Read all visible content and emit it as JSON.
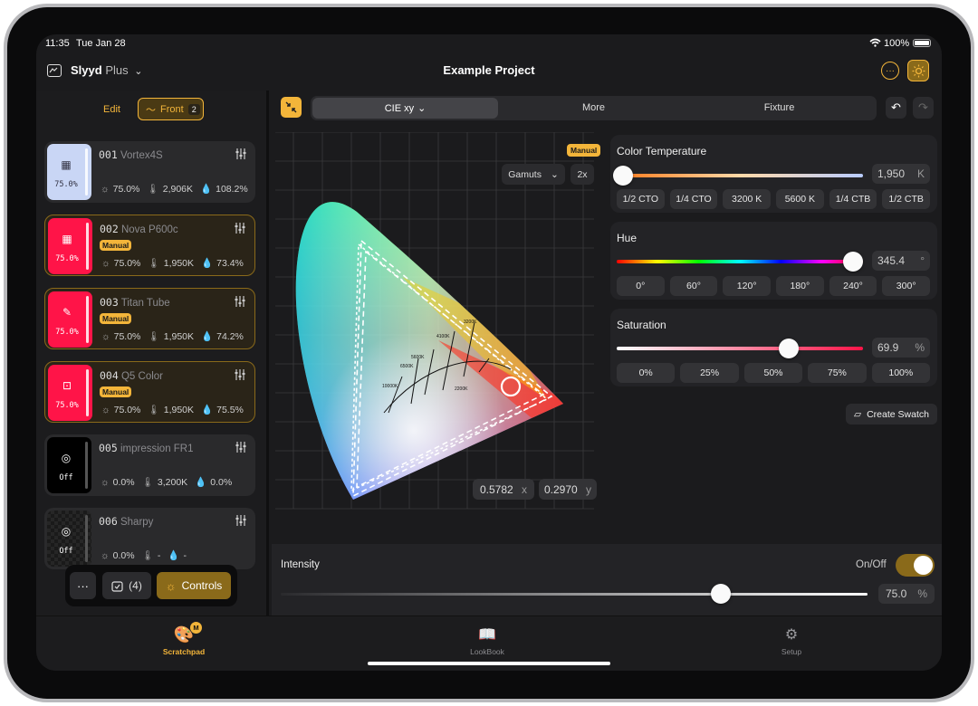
{
  "status": {
    "time": "11:35",
    "date": "Tue Jan 28",
    "battery": "100%"
  },
  "header": {
    "app_name": "Slyyd",
    "app_tier": "Plus",
    "project_title": "Example Project"
  },
  "left_bar": {
    "edit_label": "Edit",
    "group_label": "Front",
    "group_count": "2"
  },
  "fixtures": [
    {
      "id": "001",
      "name": "Vortex4S",
      "thumb_label": "75.0%",
      "thumb_color": "#c9d6f5",
      "intensity": "75.0%",
      "cct": "2,906K",
      "tint": "108.2%",
      "manual": false
    },
    {
      "id": "002",
      "name": "Nova P600c",
      "thumb_label": "75.0%",
      "thumb_color": "#ff1448",
      "intensity": "75.0%",
      "cct": "1,950K",
      "tint": "73.4%",
      "manual": true,
      "badge": "Manual"
    },
    {
      "id": "003",
      "name": "Titan Tube",
      "thumb_label": "75.0%",
      "thumb_color": "#ff1448",
      "intensity": "75.0%",
      "cct": "1,950K",
      "tint": "74.2%",
      "manual": true,
      "badge": "Manual"
    },
    {
      "id": "004",
      "name": "Q5 Color",
      "thumb_label": "75.0%",
      "thumb_color": "#ff1448",
      "intensity": "75.0%",
      "cct": "1,950K",
      "tint": "75.5%",
      "manual": true,
      "badge": "Manual"
    },
    {
      "id": "005",
      "name": "impression FR1",
      "thumb_label": "Off",
      "thumb_color": "#000000",
      "intensity": "0.0%",
      "cct": "3,200K",
      "tint": "0.0%",
      "manual": false
    },
    {
      "id": "006",
      "name": "Sharpy",
      "thumb_label": "Off",
      "thumb_color": "#1e1e1e",
      "intensity": "0.0%",
      "cct": "-",
      "tint": "-",
      "manual": false
    }
  ],
  "floating": {
    "more": "···",
    "selected": "(4)",
    "controls": "Controls"
  },
  "segments": [
    "CIE xy",
    "More",
    "Fixture"
  ],
  "cie": {
    "badge": "Manual",
    "gamuts": "Gamuts",
    "zoom": "2x",
    "x_value": "0.5782",
    "x_label": "x",
    "y_value": "0.2970",
    "y_label": "y",
    "cct_labels": [
      "10000K",
      "6500K",
      "5600K",
      "4100K",
      "3200K",
      "2200K"
    ],
    "selected_x": 0.5782,
    "selected_y": 0.297
  },
  "color_temp": {
    "title": "Color Temperature",
    "value": "1,950",
    "unit": "K",
    "level": 0.0,
    "presets": [
      "1/2 CTO",
      "1/4 CTO",
      "3200 K",
      "5600 K",
      "1/4 CTB",
      "1/2 CTB"
    ]
  },
  "hue": {
    "title": "Hue",
    "value": "345.4",
    "unit": "°",
    "level": 0.959,
    "presets": [
      "0°",
      "60°",
      "120°",
      "180°",
      "240°",
      "300°"
    ]
  },
  "saturation": {
    "title": "Saturation",
    "value": "69.9",
    "unit": "%",
    "level": 0.699,
    "presets": [
      "0%",
      "25%",
      "50%",
      "75%",
      "100%"
    ]
  },
  "swatch": {
    "label": "Create Swatch"
  },
  "intensity": {
    "title": "Intensity",
    "onoff_label": "On/Off",
    "value": "75.0",
    "unit": "%",
    "level": 0.75,
    "on": true
  },
  "tabs": [
    {
      "label": "Scratchpad",
      "badge": "M"
    },
    {
      "label": "LookBook"
    },
    {
      "label": "Setup"
    }
  ],
  "colors": {
    "accent": "#f3b53a",
    "manual_red": "#ff1448",
    "background": "#1b1b1d"
  }
}
